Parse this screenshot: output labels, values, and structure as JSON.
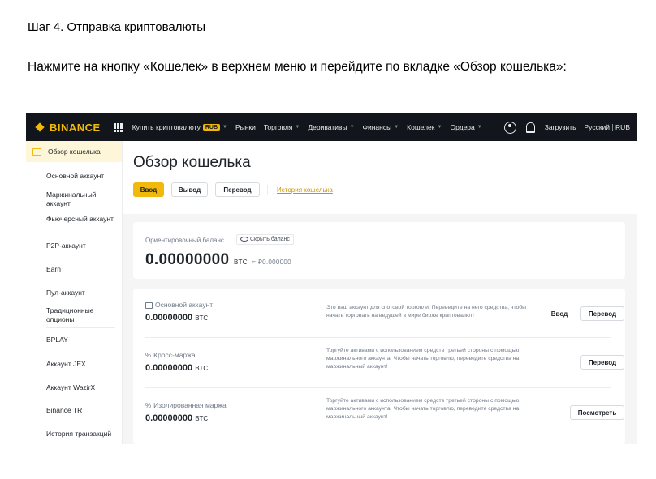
{
  "doc": {
    "heading": "Шаг 4. Отправка криптовалюты",
    "paragraph": "Нажмите на кнопку «Кошелек» в верхнем меню и перейдите по вкладке «Обзор кошелька»:"
  },
  "topbar": {
    "logo": "BINANCE",
    "nav": [
      {
        "label": "Купить криптовалюту",
        "badge": "RUB"
      },
      {
        "label": "Рынки"
      },
      {
        "label": "Торговля"
      },
      {
        "label": "Деривативы"
      },
      {
        "label": "Финансы"
      },
      {
        "label": "Кошелек"
      },
      {
        "label": "Ордера"
      }
    ],
    "upload": "Загрузить",
    "language": "Русский",
    "currency": "RUB"
  },
  "sidebar": {
    "active": "Обзор кошелька",
    "items": [
      "Основной аккаунт",
      "Маржинальный аккаунт",
      "Фьючерсный аккаунт",
      "P2P-аккаунт",
      "Earn",
      "Пул-аккаунт",
      "Традиционные опционы",
      "BPLAY",
      "Аккаунт JEX",
      "Аккаунт WazirX",
      "Binance TR",
      "История транзакций"
    ]
  },
  "main": {
    "title": "Обзор кошелька",
    "buttons": {
      "deposit": "Ввод",
      "withdraw": "Вывод",
      "transfer": "Перевод"
    },
    "history_link": "История кошелька",
    "balance": {
      "label": "Ориентировочный баланс",
      "hide": "Скрыть баланс",
      "value": "0.00000000",
      "unit": "BTC",
      "approx": "≈ ₽0.000000"
    },
    "accounts": [
      {
        "name": "Основной аккаунт",
        "value": "0.00000000",
        "unit": "BTC",
        "desc": "Это ваш аккаунт для спотовой торговли. Переведите на него средства, чтобы начать торговать на ведущей в мире бирже криптовалют!",
        "actions": [
          "Ввод",
          "Перевод"
        ]
      },
      {
        "name": "Кросс-маржа",
        "value": "0.00000000",
        "unit": "BTC",
        "desc": "Торгуйте активами с использованием средств третьей стороны с помощью маржинального аккаунта. Чтобы начать торговлю, переведите средства на маржинальный аккаунт!",
        "actions": [
          "Перевод"
        ]
      },
      {
        "name": "Изолированная маржа",
        "value": "0.00000000",
        "unit": "BTC",
        "desc": "Торгуйте активами с использованием средств третьей стороны с помощью маржинального аккаунта. Чтобы начать торговлю, переведите средства на маржинальный аккаунт!",
        "actions": [
          "Посмотреть"
        ]
      }
    ]
  },
  "colors": {
    "brand": "#f0b90b",
    "topbar_bg": "#12161c",
    "sidebar_active_bg": "#fef6d8"
  }
}
